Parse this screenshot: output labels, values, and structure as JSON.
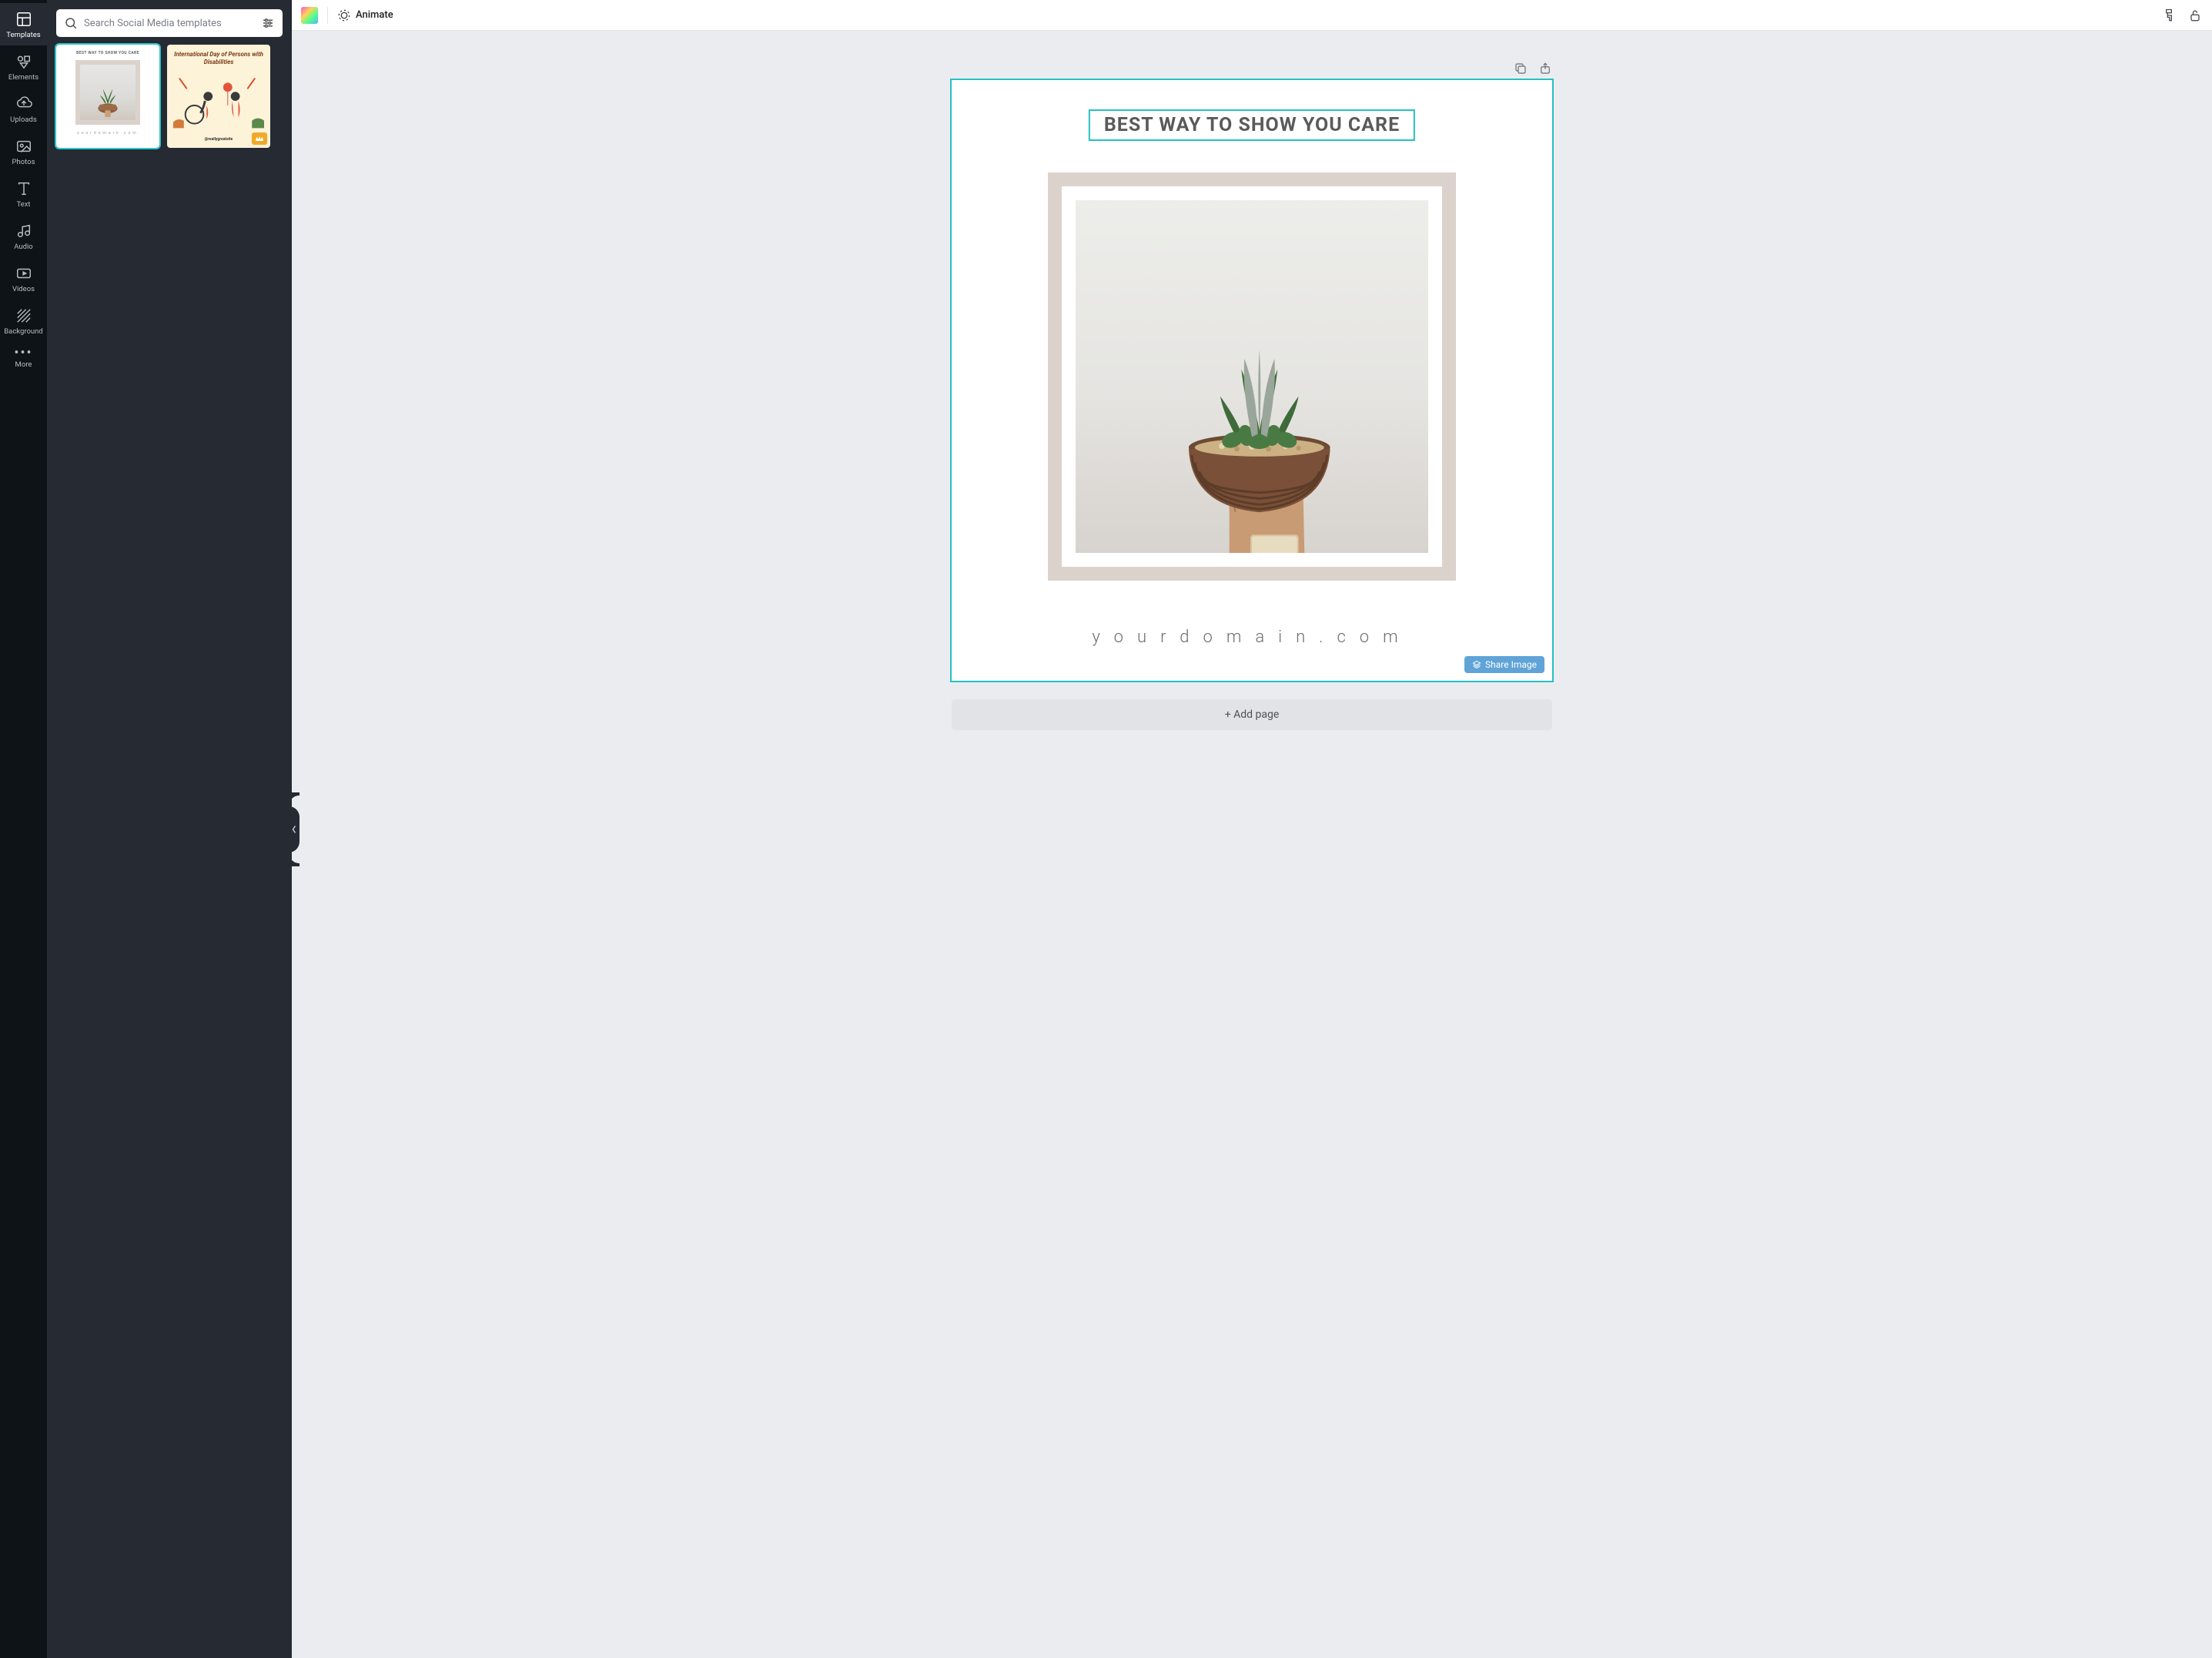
{
  "nav": {
    "items": [
      {
        "label": "Templates",
        "icon": "templates"
      },
      {
        "label": "Elements",
        "icon": "elements"
      },
      {
        "label": "Uploads",
        "icon": "uploads"
      },
      {
        "label": "Photos",
        "icon": "photos"
      },
      {
        "label": "Text",
        "icon": "text"
      },
      {
        "label": "Audio",
        "icon": "audio"
      },
      {
        "label": "Videos",
        "icon": "videos"
      },
      {
        "label": "Background",
        "icon": "background"
      },
      {
        "label": "More",
        "icon": "more"
      }
    ],
    "active_index": 0
  },
  "search": {
    "placeholder": "Search Social Media templates"
  },
  "templates": [
    {
      "title": "BEST WAY TO SHOW YOU CARE",
      "footer": "yourdomain.com",
      "selected": true
    },
    {
      "title": "International Day of Persons with Disabilities",
      "footer": "@reallygreatsite",
      "premium": true,
      "selected": false
    }
  ],
  "topbar": {
    "animate_label": "Animate"
  },
  "canvas": {
    "headline": "BEST WAY TO SHOW YOU CARE",
    "domain_text": "yourdomain.com",
    "share_label": "Share Image"
  },
  "add_page_label": "+ Add page",
  "colors": {
    "selection": "#24c1c4",
    "frame_bg": "#dcd2cc",
    "share_bg": "#5fa3d7"
  }
}
